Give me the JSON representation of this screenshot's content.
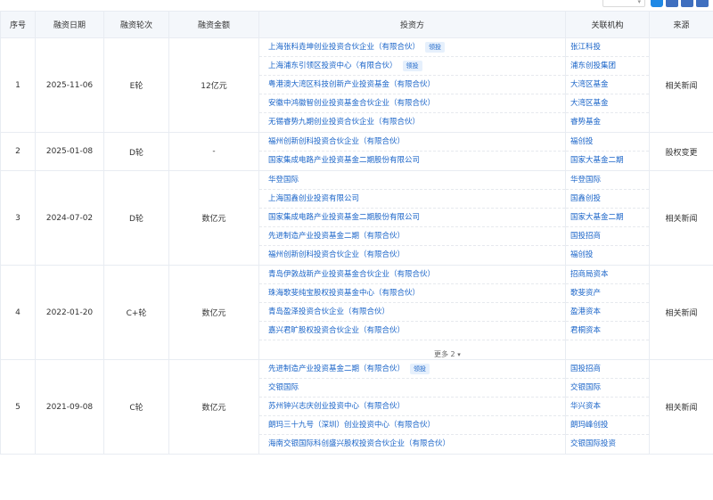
{
  "header": {
    "select_label": "",
    "columns": [
      "序号",
      "融资日期",
      "融资轮次",
      "融资金额",
      "投资方",
      "关联机构",
      "来源"
    ]
  },
  "rows": [
    {
      "index": "1",
      "date": "2025-11-06",
      "round": "E轮",
      "amount": "12亿元",
      "source": "相关新闻",
      "investors": [
        {
          "name": "上海张科垚坤创业投资合伙企业（有限合伙）",
          "badge": "领投"
        },
        {
          "name": "上海浦东引领区投资中心（有限合伙）",
          "badge": "领投"
        },
        {
          "name": "粤港澳大湾区科技创新产业投资基金（有限合伙）",
          "badge": ""
        },
        {
          "name": "安徽中鸿徽智创业投资基金合伙企业（有限合伙）",
          "badge": ""
        },
        {
          "name": "无锡睿势九期创业投资合伙企业（有限合伙）",
          "badge": ""
        }
      ],
      "orgs": [
        "张江科投",
        "浦东创投集团",
        "大湾区基金",
        "大湾区基金",
        "睿势基金"
      ]
    },
    {
      "index": "2",
      "date": "2025-01-08",
      "round": "D轮",
      "amount": "-",
      "source": "股权变更",
      "investors": [
        {
          "name": "福州创新创科投资合伙企业（有限合伙）",
          "badge": ""
        },
        {
          "name": "国家集成电路产业投资基金二期股份有限公司",
          "badge": ""
        }
      ],
      "orgs": [
        "福创投",
        "国家大基金二期"
      ]
    },
    {
      "index": "3",
      "date": "2024-07-02",
      "round": "D轮",
      "amount": "数亿元",
      "source": "相关新闻",
      "investors": [
        {
          "name": "华登国际",
          "badge": ""
        },
        {
          "name": "上海国鑫创业投资有限公司",
          "badge": ""
        },
        {
          "name": "国家集成电路产业投资基金二期股份有限公司",
          "badge": ""
        },
        {
          "name": "先进制造产业投资基金二期（有限合伙）",
          "badge": ""
        },
        {
          "name": "福州创新创科投资合伙企业（有限合伙）",
          "badge": ""
        }
      ],
      "orgs": [
        "华登国际",
        "国鑫创投",
        "国家大基金二期",
        "国投招商",
        "福创投"
      ]
    },
    {
      "index": "4",
      "date": "2022-01-20",
      "round": "C+轮",
      "amount": "数亿元",
      "source": "相关新闻",
      "investors": [
        {
          "name": "青岛伊敦战新产业投资基金合伙企业（有限合伙）",
          "badge": ""
        },
        {
          "name": "珠海歌斐纯宝股权投资基金中心（有限合伙）",
          "badge": ""
        },
        {
          "name": "青岛盈泽投资合伙企业（有限合伙）",
          "badge": ""
        },
        {
          "name": "嘉兴君旷股权投资合伙企业（有限合伙）",
          "badge": ""
        }
      ],
      "orgs": [
        "招商局资本",
        "歌斐资产",
        "盈港资本",
        "君桐资本"
      ],
      "more_label": "更多 2"
    },
    {
      "index": "5",
      "date": "2021-09-08",
      "round": "C轮",
      "amount": "数亿元",
      "source": "相关新闻",
      "investors": [
        {
          "name": "先进制造产业投资基金二期（有限合伙）",
          "badge": "领投"
        },
        {
          "name": "交银国际",
          "badge": ""
        },
        {
          "name": "苏州钟兴志庆创业投资中心（有限合伙）",
          "badge": ""
        },
        {
          "name": "朗玛三十九号（深圳）创业投资中心（有限合伙）",
          "badge": ""
        },
        {
          "name": "海南交银国际科创盛兴股权投资合伙企业（有限合伙）",
          "badge": ""
        }
      ],
      "orgs": [
        "国投招商",
        "交银国际",
        "华兴资本",
        "朗玛峰创投",
        "交银国际投资"
      ]
    }
  ],
  "colors": {
    "link": "#1a64c8",
    "header_bg": "#f4f7fb",
    "border": "#e8ecf2",
    "badge_bg": "#e6f0fc"
  }
}
